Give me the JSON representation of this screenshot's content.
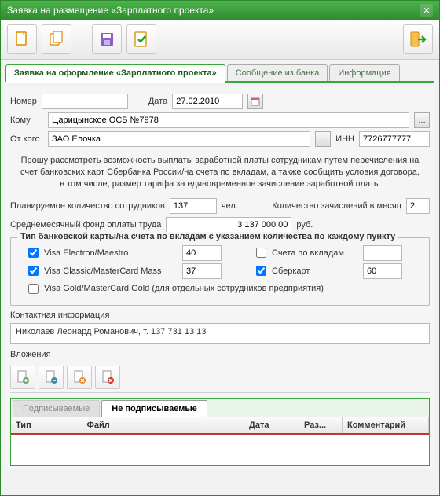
{
  "window": {
    "title": "Заявка на размещение «Зарплатного проекта»"
  },
  "tabs": {
    "main": "Заявка на оформление «Зарплатного проекта»",
    "bank_msg": "Сообщение из банка",
    "info": "Информация"
  },
  "labels": {
    "number": "Номер",
    "date": "Дата",
    "to": "Кому",
    "from": "От кого",
    "inn": "ИНН",
    "planned_emp": "Планируемое количество сотрудников",
    "people": "чел.",
    "credits_per_month": "Количество зачислений в месяц",
    "avg_fund": "Среднемесячный фонд оплаты труда",
    "rub": "руб.",
    "contact_info": "Контактная информация",
    "attachments": "Вложения",
    "fieldset_title": "Тип банковской карты/на счета по вкладам с указанием количества по каждому пункту"
  },
  "values": {
    "number": "",
    "date": "27.02.2010",
    "to": "Царицынское ОСБ №7978",
    "from": "ЗАО Елочка",
    "inn": "7726777777",
    "planned_emp": "137",
    "credits_per_month": "2",
    "avg_fund": "3 137 000.00",
    "contact": "Николаев Леонард Романович, т. 137 731 13 13"
  },
  "description": "Прошу рассмотреть возможность выплаты заработной платы сотрудникам путем перечисления на счет банковских карт Сбербанка России/на счета по вкладам, а также сообщить условия договора, в том числе, размер тарифа за единовременное зачисление заработной платы",
  "cards": {
    "visa_electron": {
      "label": "Visa Electron/Maestro",
      "checked": true,
      "count": "40"
    },
    "visa_classic": {
      "label": "Visa Classic/MasterCard Mass",
      "checked": true,
      "count": "37"
    },
    "visa_gold": {
      "label": "Visa Gold/MasterCard Gold (для отдельных сотрудников предприятия)",
      "checked": false
    },
    "deposit_accounts": {
      "label": "Счета по вкладам",
      "checked": false,
      "count": ""
    },
    "sbercard": {
      "label": "Сберкарт",
      "checked": true,
      "count": "60"
    }
  },
  "subtabs": {
    "signable": "Подписываемые",
    "not_signable": "Не подписываемые"
  },
  "grid_headers": {
    "type": "Тип",
    "file": "Файл",
    "date": "Дата",
    "size": "Раз...",
    "comment": "Комментарий"
  },
  "icons": {
    "new_doc": "new-doc-icon",
    "copy_doc": "copy-doc-icon",
    "save": "save-icon",
    "check": "check-icon",
    "exit": "exit-icon"
  }
}
